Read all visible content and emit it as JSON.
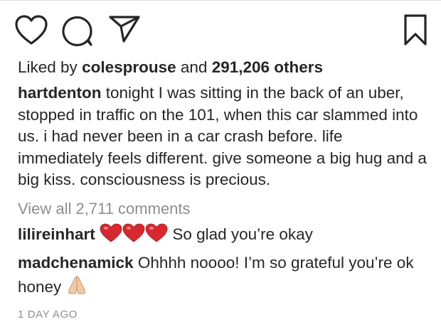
{
  "post": {
    "likes": {
      "prefix": "Liked by",
      "liker": "colesprouse",
      "conjunction": "and",
      "others": "291,206 others"
    },
    "caption": {
      "username": "hartdenton",
      "text": "tonight I was sitting in the back of an uber, stopped in traffic on the 101, when this car slammed into us. i had never been in a car crash before. life immediately feels different. give someone a big hug and a big kiss. consciousness is precious."
    },
    "view_all_comments": "View all 2,711 comments",
    "comments": [
      {
        "username": "lilireinhart",
        "emoji": "red-heart x3",
        "text": "So glad you’re okay"
      },
      {
        "username": "madchenamick",
        "text": "Ohhhh noooo! I’m so grateful you’re ok honey",
        "emoji": "folded-hands"
      }
    ],
    "timestamp": "1 DAY AGO"
  },
  "icons": {
    "like": "heart-outline-icon",
    "comment": "comment-bubble-icon",
    "share": "paper-plane-icon",
    "save": "bookmark-icon"
  },
  "colors": {
    "text": "#262626",
    "muted": "#8e8e8e",
    "heart": "#d7282f",
    "hands": "#f2c9a5"
  }
}
